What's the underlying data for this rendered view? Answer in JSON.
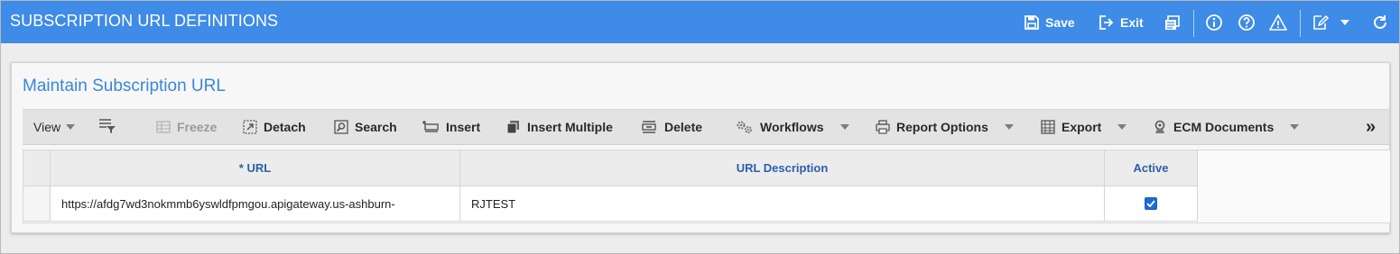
{
  "window": {
    "title": "SUBSCRIPTION URL DEFINITIONS"
  },
  "header_actions": {
    "save_label": "Save",
    "exit_label": "Exit"
  },
  "panel": {
    "title": "Maintain Subscription URL"
  },
  "toolbar": {
    "view_label": "View",
    "freeze_label": "Freeze",
    "detach_label": "Detach",
    "search_label": "Search",
    "insert_label": "Insert",
    "insert_multiple_label": "Insert Multiple",
    "delete_label": "Delete",
    "workflows_label": "Workflows",
    "report_options_label": "Report Options",
    "export_label": "Export",
    "ecm_documents_label": "ECM Documents",
    "more_label": "»"
  },
  "grid": {
    "columns": [
      "* URL",
      "URL Description",
      "Active"
    ],
    "rows": [
      {
        "url": "https://afdg7wd3nokmmb6yswldfpmgou.apigateway.us-ashburn-",
        "description": "RJTEST",
        "active": true
      }
    ]
  },
  "colors": {
    "titlebar": "#3e8be8",
    "panel_title": "#3a86d9",
    "header_text": "#2d5fa9"
  }
}
